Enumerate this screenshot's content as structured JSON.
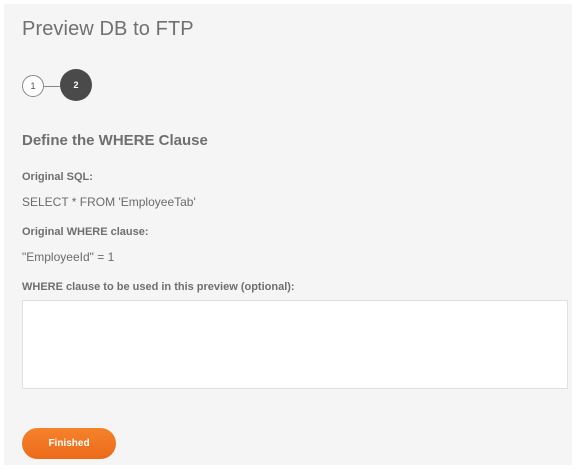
{
  "dialog": {
    "title": "Preview DB to FTP"
  },
  "stepper": {
    "steps": [
      "1",
      "2"
    ],
    "current_step": 2
  },
  "section": {
    "heading": "Define the WHERE Clause"
  },
  "original_sql": {
    "label": "Original SQL:",
    "value": "SELECT * FROM 'EmployeeTab'"
  },
  "original_where": {
    "label": "Original WHERE clause:",
    "value": "\"EmployeeId\" = 1"
  },
  "preview_where": {
    "label": "WHERE clause to be used in this preview (optional):",
    "value": "",
    "placeholder": ""
  },
  "actions": {
    "finished_label": "Finished"
  },
  "colors": {
    "accent": "#f07a22",
    "active_step": "#4a4a4a",
    "panel_background": "#f5f5f5"
  }
}
